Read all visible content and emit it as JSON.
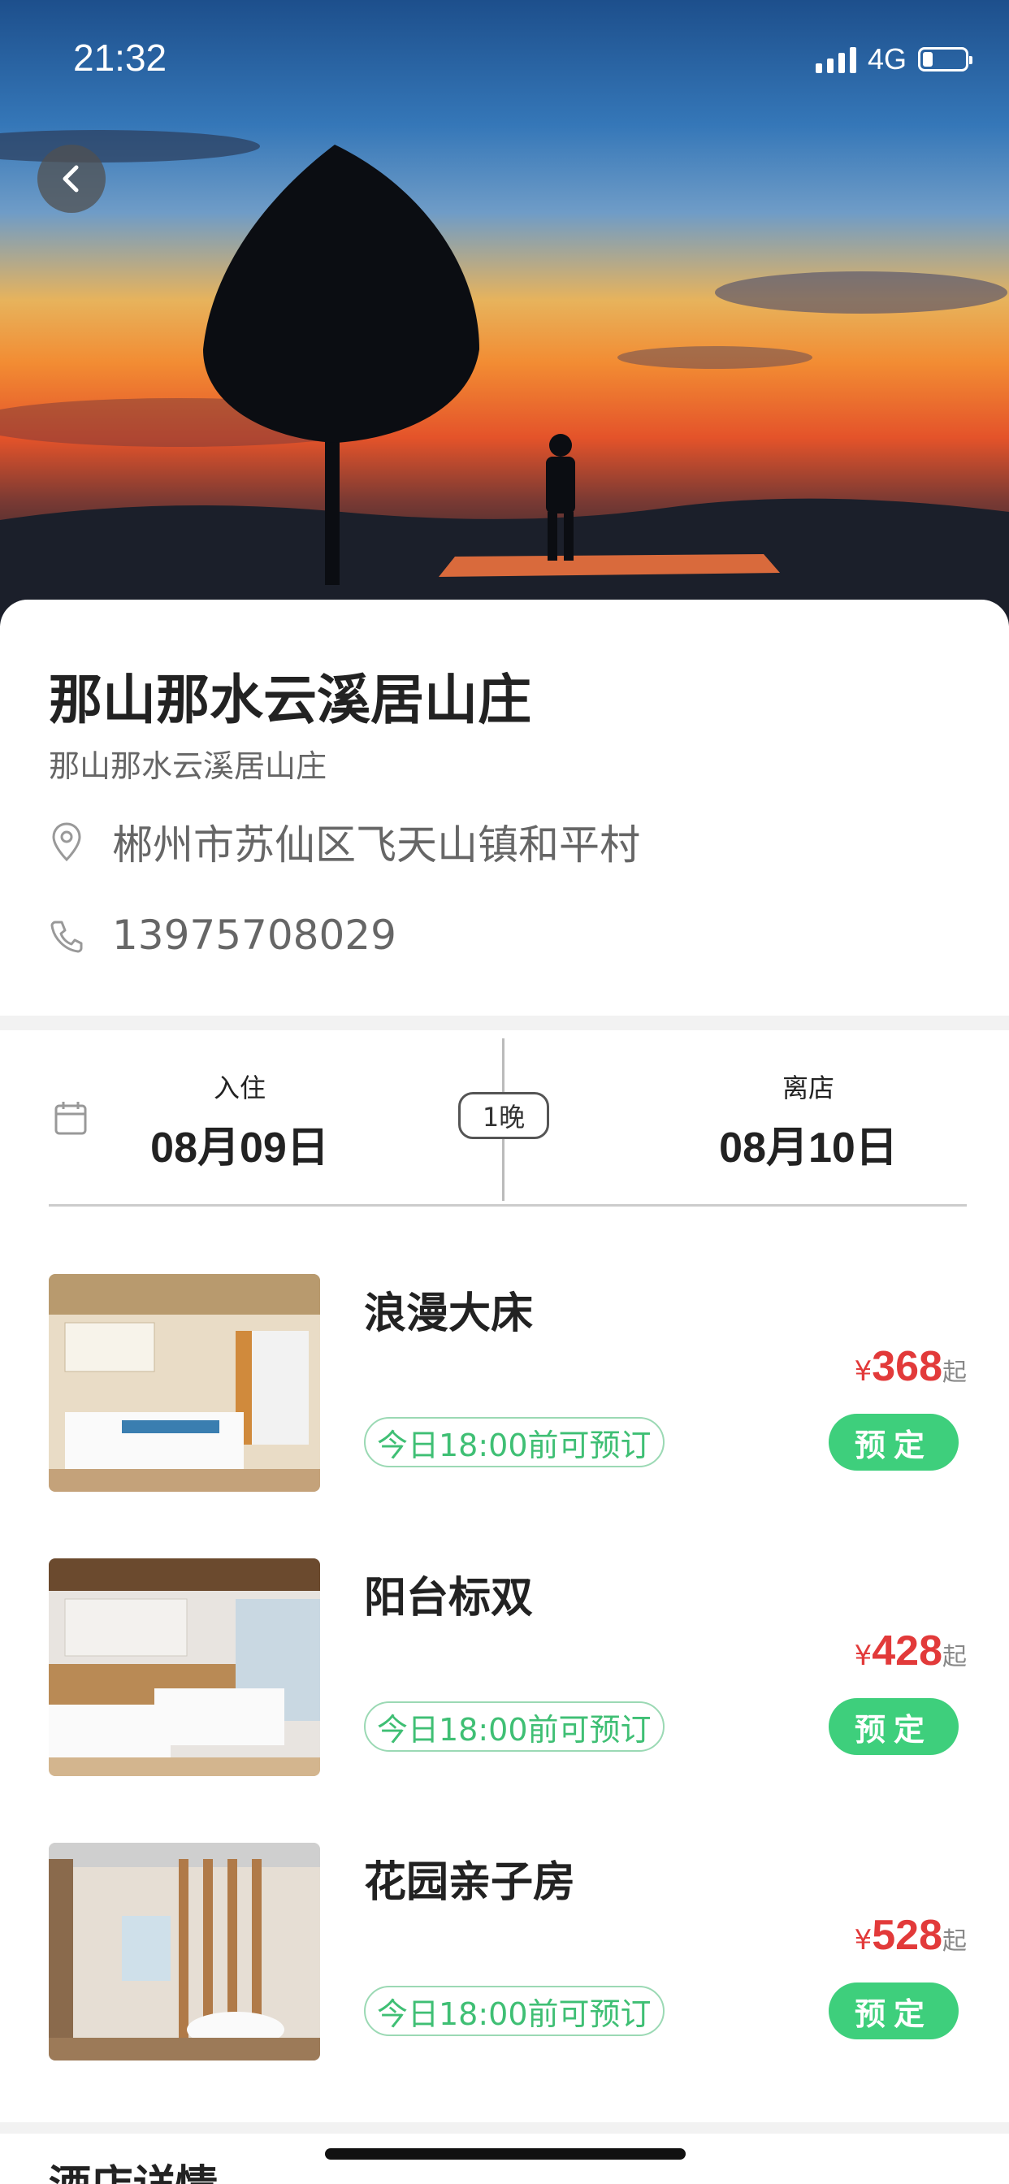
{
  "status_bar": {
    "time": "21:32",
    "network": "4G"
  },
  "hero": {
    "back_icon": "chevron-left-icon"
  },
  "hotel": {
    "name": "那山那水云溪居山庄",
    "subname": "那山那水云溪居山庄",
    "address": "郴州市苏仙区飞天山镇和平村",
    "phone": "13975708029",
    "address_icon": "location-pin-icon",
    "phone_icon": "phone-icon"
  },
  "stay": {
    "checkin_label": "入住",
    "checkin_date": "08月09日",
    "nights": "1晚",
    "checkout_label": "离店",
    "checkout_date": "08月10日",
    "calendar_icon": "calendar-icon"
  },
  "rooms": [
    {
      "name": "浪漫大床",
      "tag": "今日18:00前可预订",
      "currency": "¥",
      "price": "368",
      "suffix": "起",
      "book_label": "预定"
    },
    {
      "name": "阳台标双",
      "tag": "今日18:00前可预订",
      "currency": "¥",
      "price": "428",
      "suffix": "起",
      "book_label": "预定"
    },
    {
      "name": "花园亲子房",
      "tag": "今日18:00前可预订",
      "currency": "¥",
      "price": "528",
      "suffix": "起",
      "book_label": "预定"
    }
  ],
  "next_section": {
    "title": "酒店详情"
  },
  "colors": {
    "accent_green": "#3ecf7c",
    "price_red": "#e23a3a"
  }
}
